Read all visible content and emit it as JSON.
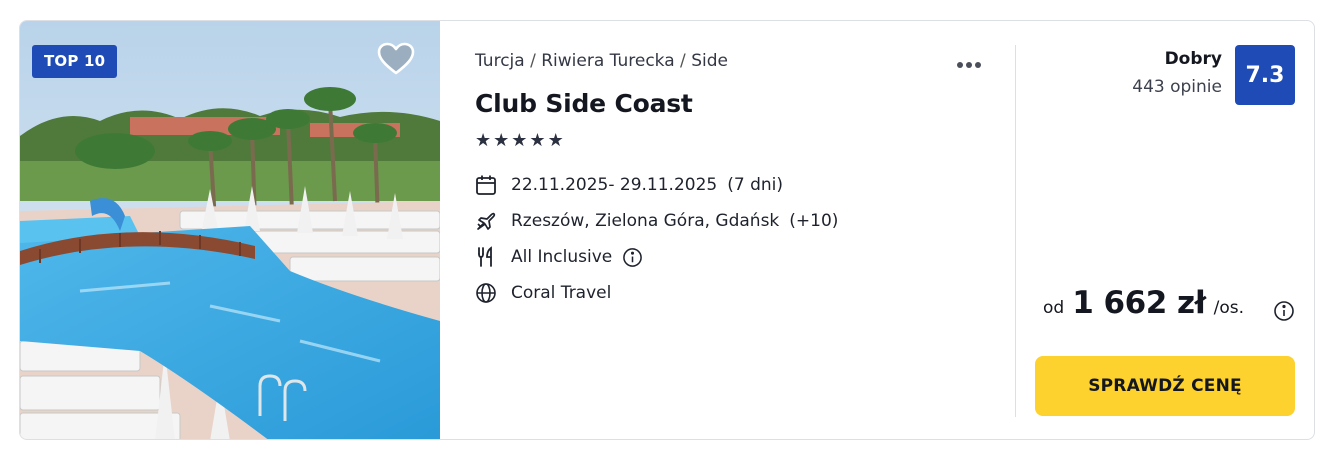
{
  "listing": {
    "badge": "TOP 10",
    "breadcrumb": [
      "Turcja",
      "Riwiera Turecka",
      "Side"
    ],
    "hotel_name": "Club Side Coast",
    "stars": 5,
    "dates": "22.11.2025- 29.11.2025",
    "duration": "(7 dni)",
    "departures": "Rzeszów, Zielona Góra, Gdańsk",
    "departures_extra": "(+10)",
    "board": "All Inclusive",
    "operator": "Coral Travel",
    "rating_label": "Dobry",
    "rating_count": "443 opinie",
    "rating_score": "7.3",
    "price_prefix": "od",
    "price": "1 662 zł",
    "price_suffix": "/os.",
    "cta_label": "SPRAWDŹ CENĘ"
  },
  "icons": {
    "favorite": "heart-outline-icon",
    "more": "ellipsis-icon",
    "dates": "calendar-icon",
    "departures": "plane-icon",
    "board": "cutlery-icon",
    "operator": "globe-icon",
    "info": "info-circle-icon"
  },
  "colors": {
    "brand_blue": "#1f4bb6",
    "cta_yellow": "#fdd12e",
    "text_dark": "#14171f"
  }
}
